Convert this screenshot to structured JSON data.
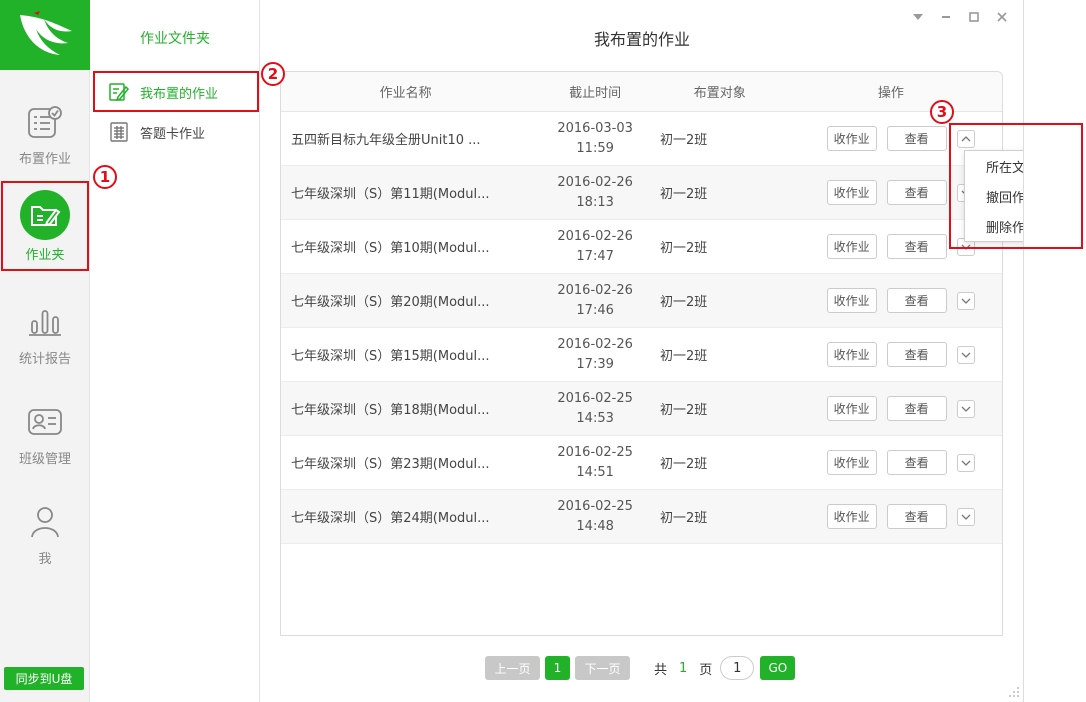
{
  "colors": {
    "brand": "#22b22a",
    "annotation": "#e30c17"
  },
  "nav": {
    "items": [
      {
        "label": "布置作业",
        "icon": "assign-homework-icon"
      },
      {
        "label": "作业夹",
        "icon": "homework-folder-icon"
      },
      {
        "label": "统计报告",
        "icon": "statistics-chart-icon"
      },
      {
        "label": "班级管理",
        "icon": "class-card-icon"
      },
      {
        "label": "我",
        "icon": "user-icon"
      }
    ],
    "active_index": 1,
    "sync_label": "同步到U盘"
  },
  "folders": {
    "title": "作业文件夹",
    "items": [
      {
        "label": "我布置的作业",
        "icon": "edit-document-icon"
      },
      {
        "label": "答题卡作业",
        "icon": "answer-card-icon"
      }
    ],
    "active_index": 0
  },
  "main": {
    "title": "我布置的作业",
    "columns": [
      "作业名称",
      "截止时间",
      "布置对象",
      "操作"
    ],
    "collect_label": "收作业",
    "view_label": "查看",
    "rows": [
      {
        "name": "五四新目标九年级全册Unit10  ...",
        "date": "2016-03-03",
        "time": "11:59",
        "target": "初一2班"
      },
      {
        "name": "七年级深圳（S）第11期(Modul...",
        "date": "2016-02-26",
        "time": "18:13",
        "target": "初一2班"
      },
      {
        "name": "七年级深圳（S）第10期(Modul...",
        "date": "2016-02-26",
        "time": "17:47",
        "target": "初一2班"
      },
      {
        "name": "七年级深圳（S）第20期(Modul...",
        "date": "2016-02-26",
        "time": "17:46",
        "target": "初一2班"
      },
      {
        "name": "七年级深圳（S）第15期(Modul...",
        "date": "2016-02-26",
        "time": "17:39",
        "target": "初一2班"
      },
      {
        "name": "七年级深圳（S）第18期(Modul...",
        "date": "2016-02-25",
        "time": "14:53",
        "target": "初一2班"
      },
      {
        "name": "七年级深圳（S）第23期(Modul...",
        "date": "2016-02-25",
        "time": "14:51",
        "target": "初一2班"
      },
      {
        "name": "七年级深圳（S）第24期(Modul...",
        "date": "2016-02-25",
        "time": "14:48",
        "target": "初一2班"
      }
    ]
  },
  "dropdown": {
    "items": [
      "所在文件夹",
      "撤回作业",
      "删除作业"
    ]
  },
  "pager": {
    "prev_label": "上一页",
    "current_page": "1",
    "next_label": "下一页",
    "total_prefix": "共",
    "total_pages": "1",
    "total_suffix": "页",
    "input_value": "1",
    "go_label": "GO"
  },
  "annotations": [
    "1",
    "2",
    "3"
  ]
}
